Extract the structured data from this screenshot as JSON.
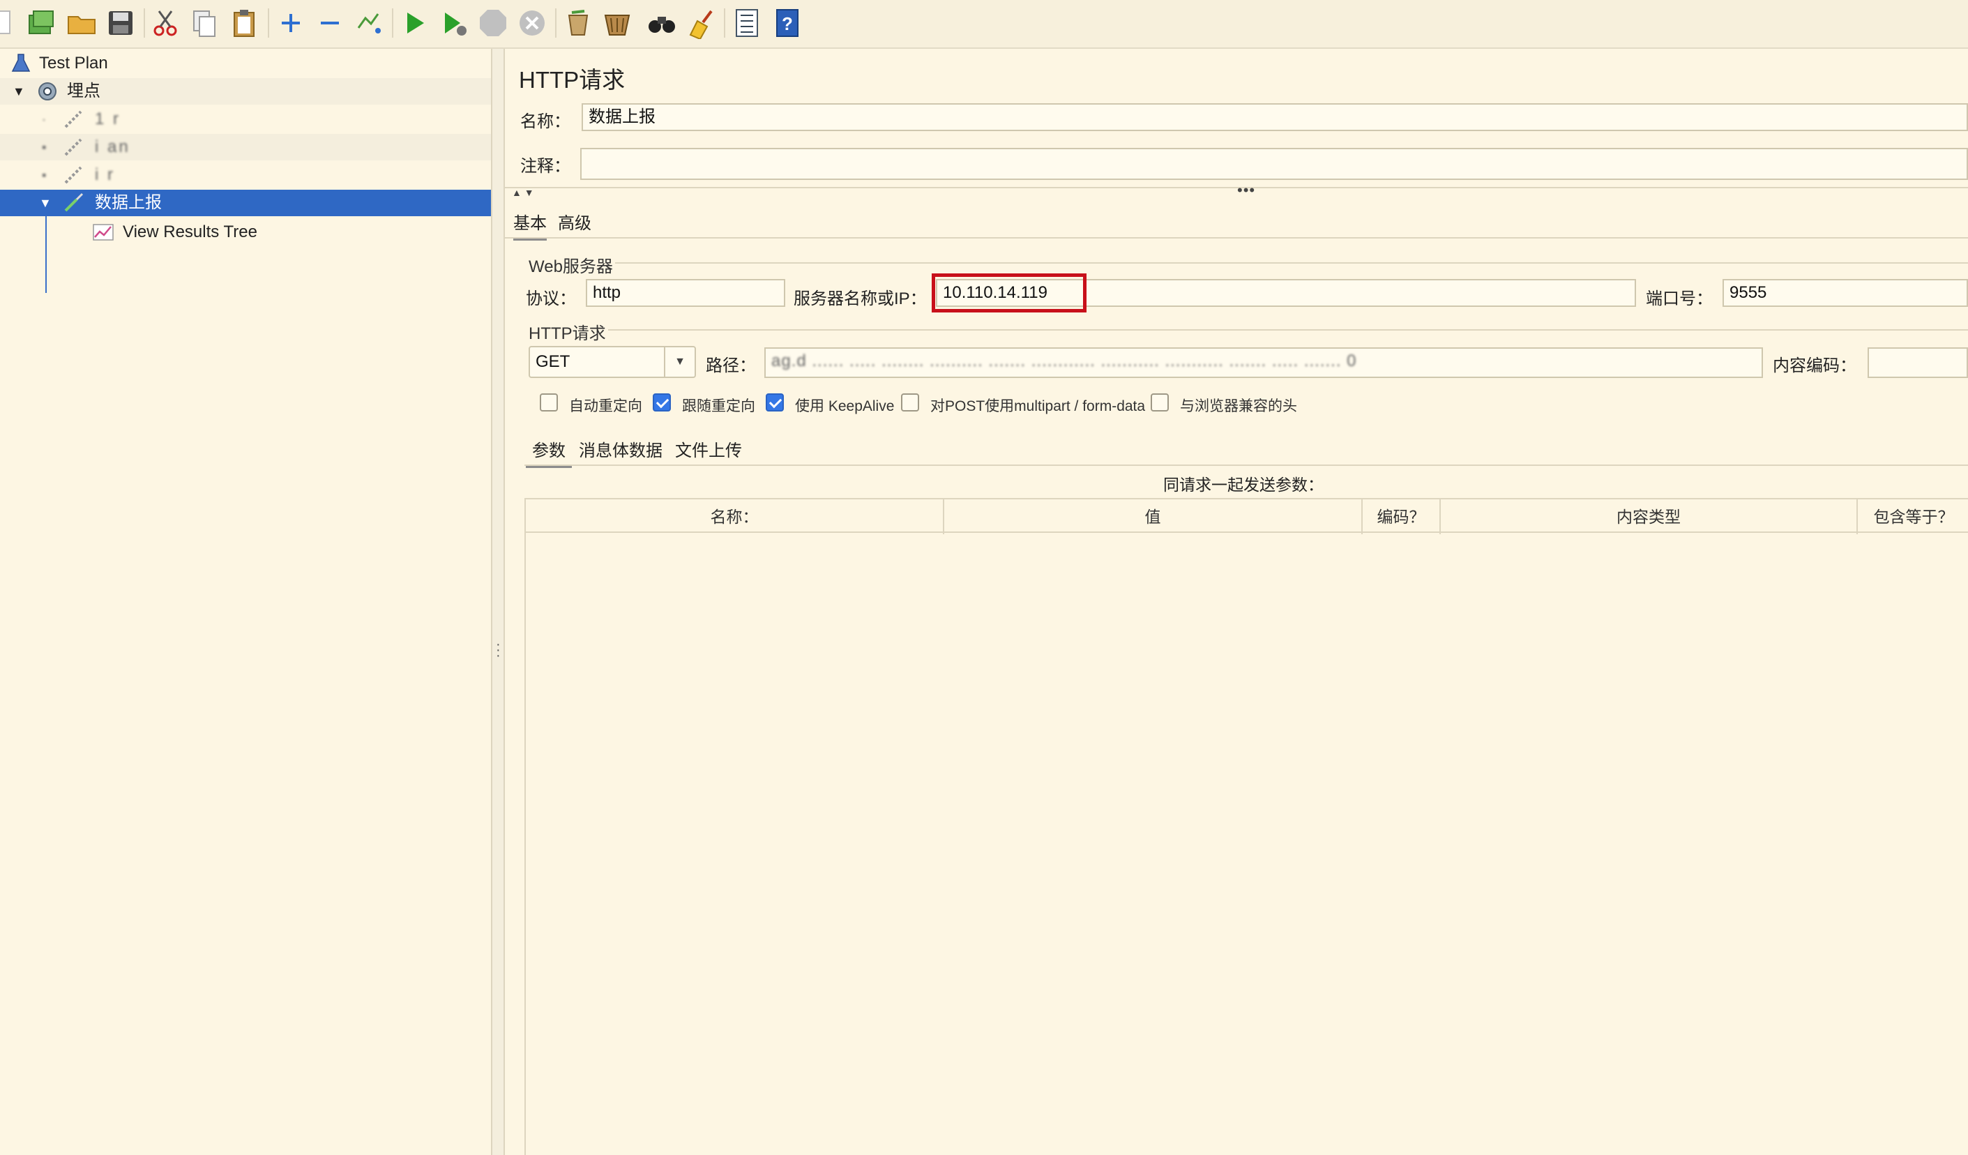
{
  "toolbar": {
    "icons": [
      "new-icon",
      "templates-icon",
      "open-icon",
      "save-icon",
      "cut-icon",
      "copy-icon",
      "paste-icon",
      "expand-icon",
      "collapse-icon",
      "toggle-icon",
      "start-icon",
      "start-no-pause-icon",
      "stop-icon",
      "shutdown-icon",
      "clear-icon",
      "clear-all-icon",
      "search-icon",
      "reset-search-icon",
      "function-helper-icon",
      "help-icon"
    ]
  },
  "tree": {
    "test_plan": "Test Plan",
    "thread_group": "埋点",
    "sampler_1": "1 r",
    "sampler_2": "i an",
    "sampler_3": "i r",
    "selected_sampler": "数据上报",
    "listener": "View Results Tree"
  },
  "panel": {
    "title": "HTTP请求",
    "name_label": "名称：",
    "name_value": "数据上报",
    "comment_label": "注释：",
    "comment_value": "",
    "tabs": [
      "基本",
      "高级"
    ],
    "web_server": {
      "group_title": "Web服务器",
      "protocol_label": "协议：",
      "protocol_value": "http",
      "server_label": "服务器名称或IP：",
      "server_value": "10.110.14.119",
      "port_label": "端口号：",
      "port_value": "9555"
    },
    "http_request": {
      "group_title": "HTTP请求",
      "method_value": "GET",
      "path_label": "路径：",
      "path_value": "ag.d ...... ..... ........ .......... ....... ............ ........... ........... ....... ..... ....... 0",
      "encoding_label": "内容编码：",
      "encoding_value": ""
    },
    "options": [
      {
        "label": "自动重定向",
        "checked": false
      },
      {
        "label": "跟随重定向",
        "checked": true
      },
      {
        "label": "使用 KeepAlive",
        "checked": true
      },
      {
        "label": "对POST使用multipart / form-data",
        "checked": false
      },
      {
        "label": "与浏览器兼容的头",
        "checked": false
      }
    ],
    "sub_tabs": [
      "参数",
      "消息体数据",
      "文件上传"
    ],
    "params_caption": "同请求一起发送参数：",
    "table_headers": [
      "名称：",
      "值",
      "编码？",
      "内容类型",
      "包含等于？"
    ]
  }
}
